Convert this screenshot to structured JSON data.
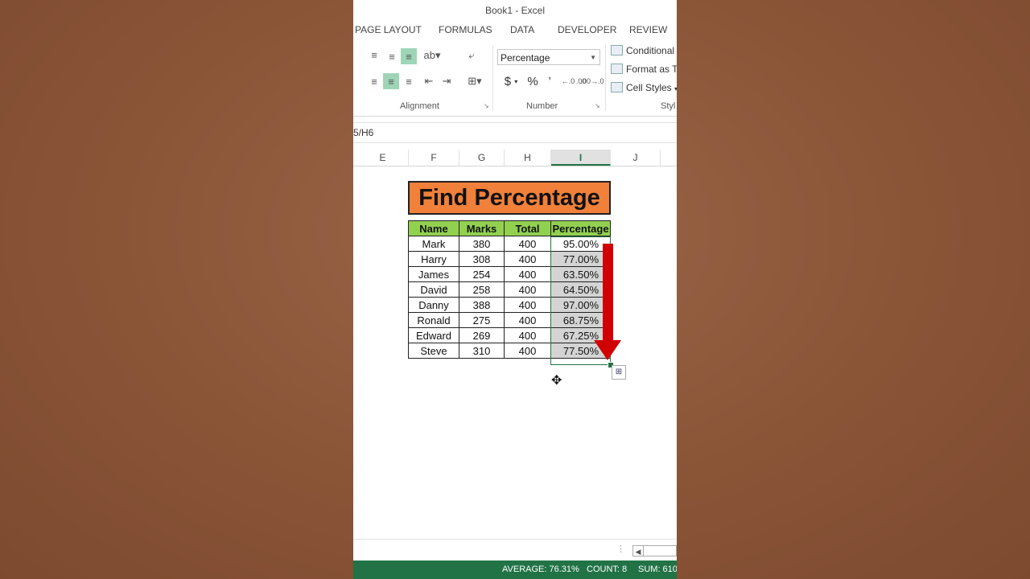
{
  "window": {
    "title": "Book1 - Excel"
  },
  "tabs": [
    "PAGE LAYOUT",
    "FORMULAS",
    "DATA",
    "DEVELOPER",
    "REVIEW"
  ],
  "ribbon": {
    "groups": {
      "alignment": "Alignment",
      "number": "Number",
      "styles": "Styl"
    },
    "number_format": "Percentage",
    "number_buttons": {
      "currency": "$",
      "percent": "%",
      "comma": "’",
      "inc_decimal": "←.0 .00",
      "dec_decimal": ".00→.0"
    },
    "styles": {
      "conditional": "Conditional",
      "format_as_table": "Format as Ta",
      "cell_styles": "Cell Styles"
    }
  },
  "formula_bar": {
    "text": "5/H6"
  },
  "columns": [
    "E",
    "F",
    "G",
    "H",
    "I",
    "J"
  ],
  "selected_column": "I",
  "sheet": {
    "title": "Find Percentage",
    "headers": [
      "Name",
      "Marks",
      "Total",
      "Percentage"
    ],
    "rows": [
      [
        "Mark",
        "380",
        "400",
        "95.00%"
      ],
      [
        "Harry",
        "308",
        "400",
        "77.00%"
      ],
      [
        "James",
        "254",
        "400",
        "63.50%"
      ],
      [
        "David",
        "258",
        "400",
        "64.50%"
      ],
      [
        "Danny",
        "388",
        "400",
        "97.00%"
      ],
      [
        "Ronald",
        "275",
        "400",
        "68.75%"
      ],
      [
        "Edward",
        "269",
        "400",
        "67.25%"
      ],
      [
        "Steve",
        "310",
        "400",
        "77.50%"
      ]
    ]
  },
  "status_bar": {
    "average": "AVERAGE: 76.31%",
    "count": "COUNT: 8",
    "sum": "SUM: 610"
  },
  "colors": {
    "excel_green": "#217346",
    "header_fill": "#92d050",
    "title_fill": "#f0803a",
    "arrow": "#d10000"
  }
}
